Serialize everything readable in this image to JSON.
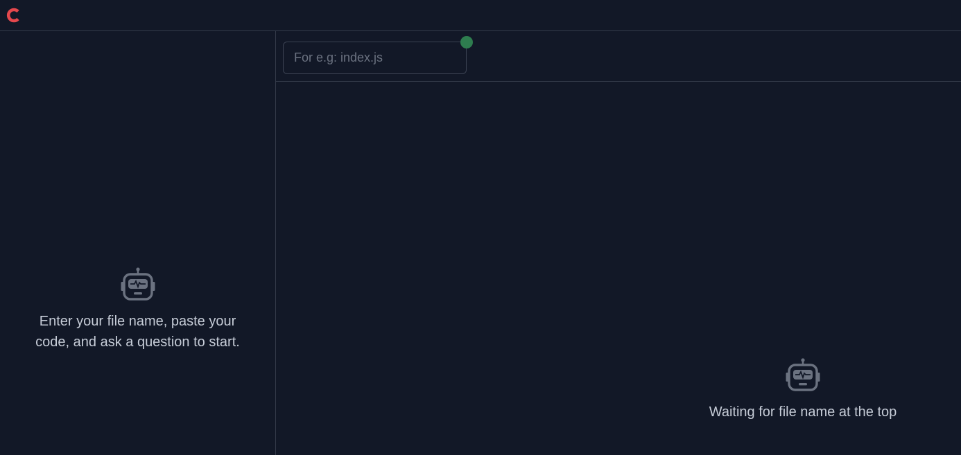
{
  "header": {
    "logo_icon": "c-logo-icon",
    "logo_color": "#e5484d"
  },
  "sidebar": {
    "empty_icon": "robot-icon",
    "empty_message": "Enter your file name, paste your code, and ask a question to start."
  },
  "main": {
    "file_input": {
      "value": "",
      "placeholder": "For e.g: index.js"
    },
    "status_color": "#2e7d4f",
    "empty_icon": "robot-icon",
    "empty_message": "Waiting for file name at the top"
  }
}
